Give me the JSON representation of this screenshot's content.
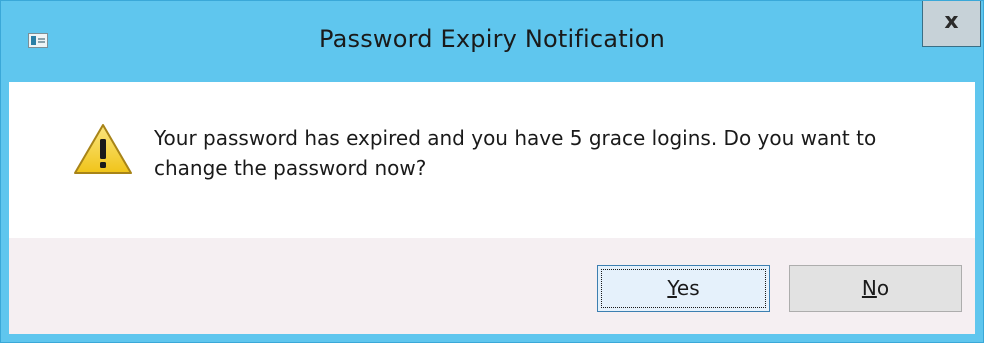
{
  "window": {
    "title": "Password Expiry Notification",
    "close_label": "x"
  },
  "dialog": {
    "icon": "warning-icon",
    "message": "Your password has expired and you have 5 grace logins. Do you want to change the password now?"
  },
  "buttons": {
    "yes": {
      "mnemonic": "Y",
      "rest": "es"
    },
    "no": {
      "mnemonic": "N",
      "rest": "o"
    }
  },
  "colors": {
    "titlebar": "#5fc6ee",
    "content_bg": "#ffffff",
    "footer_bg": "#f5eff2",
    "warning_yellow": "#f6d32d"
  }
}
